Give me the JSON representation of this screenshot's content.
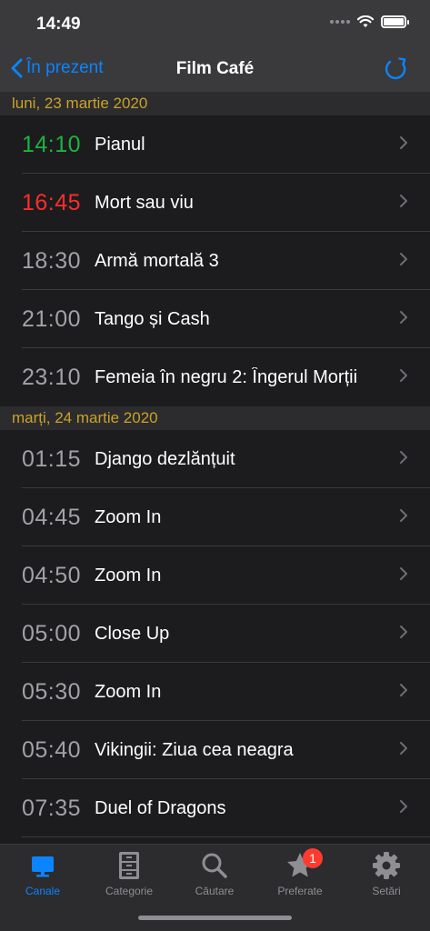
{
  "status": {
    "time": "14:49"
  },
  "nav": {
    "back_label": "În prezent",
    "title": "Film Café"
  },
  "sections": [
    {
      "header": "luni, 23 martie 2020",
      "rows": [
        {
          "time": "14:10",
          "title": "Pianul",
          "time_color": "#1db33d"
        },
        {
          "time": "16:45",
          "title": "Mort sau viu",
          "time_color": "#ff2d2d"
        },
        {
          "time": "18:30",
          "title": "Armă mortală 3",
          "time_color": "#a1a1a6"
        },
        {
          "time": "21:00",
          "title": "Tango și Cash",
          "time_color": "#a1a1a6"
        },
        {
          "time": "23:10",
          "title": "Femeia în negru 2: Îngerul Morții",
          "time_color": "#a1a1a6"
        }
      ]
    },
    {
      "header": "marți, 24 martie 2020",
      "rows": [
        {
          "time": "01:15",
          "title": "Django dezlănțuit",
          "time_color": "#a1a1a6"
        },
        {
          "time": "04:45",
          "title": "Zoom In",
          "time_color": "#a1a1a6"
        },
        {
          "time": "04:50",
          "title": "Zoom In",
          "time_color": "#a1a1a6"
        },
        {
          "time": "05:00",
          "title": "Close Up",
          "time_color": "#a1a1a6"
        },
        {
          "time": "05:30",
          "title": "Zoom In",
          "time_color": "#a1a1a6"
        },
        {
          "time": "05:40",
          "title": "Vikingii: Ziua cea neagra",
          "time_color": "#a1a1a6"
        },
        {
          "time": "07:35",
          "title": "Duel of Dragons",
          "time_color": "#a1a1a6"
        }
      ]
    }
  ],
  "tabs": [
    {
      "label": "Canale",
      "icon": "tv-icon",
      "active": true
    },
    {
      "label": "Categorie",
      "icon": "cabinet-icon",
      "active": false
    },
    {
      "label": "Căutare",
      "icon": "search-icon",
      "active": false
    },
    {
      "label": "Preferate",
      "icon": "star-icon",
      "active": false,
      "badge": "1"
    },
    {
      "label": "Setări",
      "icon": "gear-icon",
      "active": false
    }
  ],
  "colors": {
    "accent": "#0a84ff",
    "section_header": "#c9a227",
    "badge": "#ff3b30"
  }
}
